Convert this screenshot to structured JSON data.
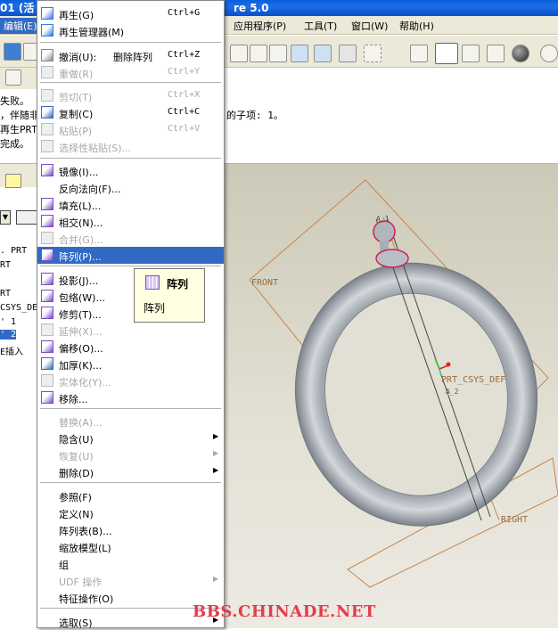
{
  "window": {
    "title_left": "01 (活",
    "title_right": "re 5.0"
  },
  "menubar": {
    "active": "编辑(E)",
    "items": [
      "应用程序(P)",
      "工具(T)",
      "窗口(W)",
      "帮助(H)"
    ]
  },
  "messages": {
    "lines": [
      "失败。",
      "，伴随非",
      "再生PRT(",
      "完成。"
    ],
    "continuation": "的子项: 1。"
  },
  "model_tree": {
    "items": [
      ". PRT",
      "RT",
      "RT",
      "CSYS_DE",
      "' 1",
      "' 2",
      "E插入"
    ],
    "selected_index": 5
  },
  "edit_menu": {
    "items": [
      {
        "label": "再生(G)",
        "shortcut": "Ctrl+G",
        "enabled": true,
        "icon": "regenerate-icon"
      },
      {
        "label": "再生管理器(M)",
        "enabled": true,
        "icon": "regen-manager-icon"
      },
      {
        "label": "撤消(U):",
        "extra": "删除阵列",
        "shortcut": "Ctrl+Z",
        "enabled": true,
        "icon": "undo-icon"
      },
      {
        "label": "重做(R)",
        "shortcut": "Ctrl+Y",
        "enabled": false,
        "icon": "redo-icon"
      },
      {
        "label": "剪切(T)",
        "shortcut": "Ctrl+X",
        "enabled": false,
        "icon": "cut-icon"
      },
      {
        "label": "复制(C)",
        "shortcut": "Ctrl+C",
        "enabled": true,
        "icon": "copy-icon"
      },
      {
        "label": "粘贴(P)",
        "shortcut": "Ctrl+V",
        "enabled": false,
        "icon": "paste-icon"
      },
      {
        "label": "选择性粘贴(S)...",
        "enabled": false,
        "icon": "paste-special-icon"
      },
      {
        "label": "镜像(I)...",
        "enabled": true,
        "icon": "mirror-icon"
      },
      {
        "label": "反向法向(F)...",
        "enabled": true
      },
      {
        "label": "填充(L)...",
        "enabled": true,
        "icon": "fill-icon"
      },
      {
        "label": "相交(N)...",
        "enabled": true,
        "icon": "intersect-icon"
      },
      {
        "label": "合并(G)...",
        "enabled": false,
        "icon": "merge-icon"
      },
      {
        "label": "阵列(P)...",
        "enabled": true,
        "highlighted": true,
        "icon": "pattern-icon"
      },
      {
        "label": "投影(J)...",
        "enabled": true,
        "icon": "project-icon"
      },
      {
        "label": "包络(W)...",
        "enabled": true,
        "icon": "wrap-icon"
      },
      {
        "label": "修剪(T)...",
        "enabled": true,
        "icon": "trim-icon"
      },
      {
        "label": "延伸(X)...",
        "enabled": false,
        "icon": "extend-icon"
      },
      {
        "label": "偏移(O)...",
        "enabled": true,
        "icon": "offset-icon"
      },
      {
        "label": "加厚(K)...",
        "enabled": true,
        "icon": "thicken-icon"
      },
      {
        "label": "实体化(Y)...",
        "enabled": false,
        "icon": "solidify-icon"
      },
      {
        "label": "移除...",
        "enabled": true,
        "icon": "remove-icon"
      },
      {
        "label": "替换(A)...",
        "enabled": false
      },
      {
        "label": "隐含(U)",
        "enabled": true,
        "submenu": true
      },
      {
        "label": "恢复(U)",
        "enabled": false,
        "submenu": true
      },
      {
        "label": "删除(D)",
        "enabled": true,
        "submenu": true
      },
      {
        "label": "参照(F)",
        "enabled": true
      },
      {
        "label": "定义(N)",
        "enabled": true
      },
      {
        "label": "阵列表(B)...",
        "enabled": true
      },
      {
        "label": "缩放模型(L)",
        "enabled": true
      },
      {
        "label": "组",
        "enabled": true
      },
      {
        "label": "UDF 操作",
        "enabled": false,
        "submenu": true
      },
      {
        "label": "特征操作(O)",
        "enabled": true
      },
      {
        "label": "选取(S)",
        "enabled": true,
        "submenu": true
      }
    ]
  },
  "tooltip": {
    "title": "阵列",
    "description": "阵列"
  },
  "viewport": {
    "labels": {
      "front": "FRONT",
      "csys": "PRT_CSYS_DEF",
      "right": "RIGHT",
      "a1": "A_1",
      "a2": "A_2"
    }
  },
  "watermark": "BBS.CHINADE.NET"
}
